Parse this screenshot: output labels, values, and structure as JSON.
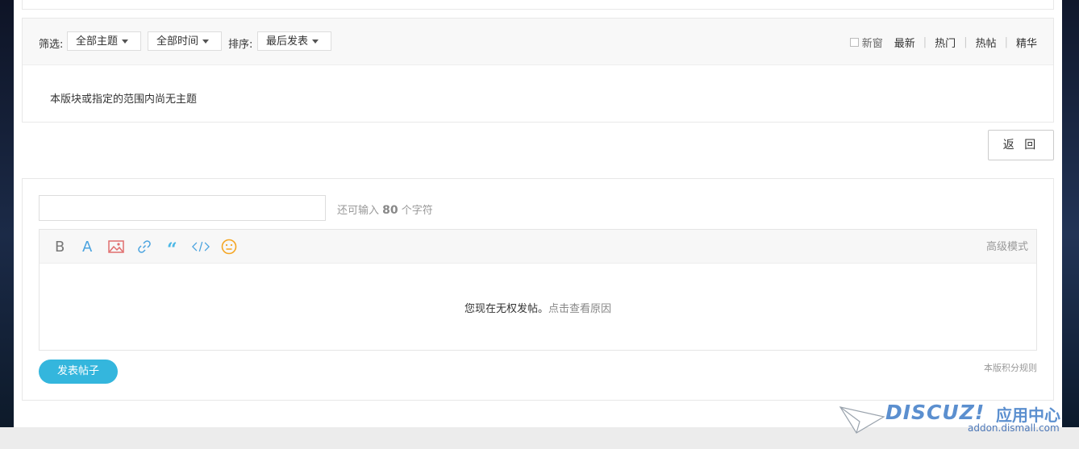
{
  "filter": {
    "label": "筛选:",
    "topic_dropdown": "全部主题",
    "time_dropdown": "全部时间",
    "sort_label": "排序:",
    "sort_dropdown": "最后发表",
    "new_window": "新窗",
    "tabs": [
      "最新",
      "热门",
      "热帖",
      "精华"
    ]
  },
  "list": {
    "empty_message": "本版块或指定的范围内尚无主题"
  },
  "return_button": "返 回",
  "post": {
    "title_value": "",
    "char_hint_prefix": "还可输入",
    "char_count": "80",
    "char_hint_suffix": "个字符",
    "toolbar": {
      "icons": [
        "bold-icon",
        "font-color-icon",
        "image-icon",
        "link-icon",
        "quote-icon",
        "code-icon",
        "emoji-icon"
      ],
      "advanced_mode": "高级模式"
    },
    "no_permission_text": "您现在无权发帖。",
    "no_permission_link": "点击查看原因",
    "submit_button": "发表帖子",
    "rules_link": "本版积分规则"
  },
  "watermark": {
    "logo_text": "DISCUZ!",
    "logo_cn": "应用中心",
    "url": "addon.dismall.com"
  },
  "colors": {
    "accent": "#34b6dd",
    "link_grey": "#888888",
    "bold_icon": "#777777",
    "font_icon": "#4aa3df",
    "image_icon": "#e06e6e",
    "link_icon": "#4aa3df",
    "quote_icon": "#4ab7e6",
    "code_icon": "#4aa3df",
    "emoji_icon": "#f5a623"
  }
}
